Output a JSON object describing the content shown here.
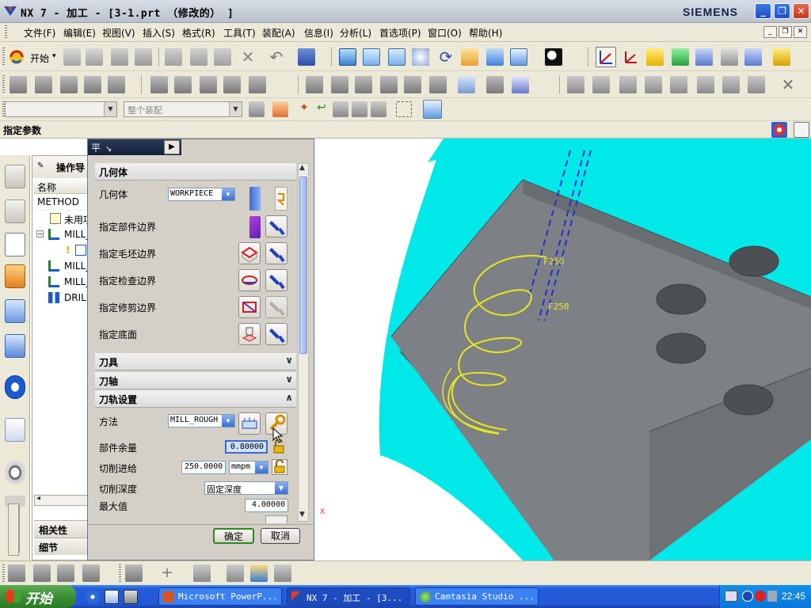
{
  "window": {
    "title": "NX 7 - 加工 - [3-1.prt （修改的） ]",
    "brand": "SIEMENS",
    "controls": [
      "_",
      "❐",
      "✕"
    ]
  },
  "menu": {
    "items": [
      "文件(F)",
      "编辑(E)",
      "视图(V)",
      "插入(S)",
      "格式(R)",
      "工具(T)",
      "装配(A)",
      "信息(I)",
      "分析(L)",
      "首选项(P)",
      "窗口(O)",
      "帮助(H)"
    ]
  },
  "toolbar": {
    "start_label": "开始",
    "start_arrow": "▾"
  },
  "selection_bar": {
    "filter_value": "",
    "scope_value": "整个装配"
  },
  "status": {
    "prompt": "指定参数"
  },
  "navigator": {
    "title": "操作导",
    "column_name": "名称",
    "rows": [
      {
        "label": "METHOD"
      },
      {
        "label": "未用项"
      },
      {
        "label": "MILL_"
      },
      {
        "label": "MILL_"
      },
      {
        "label": "MILL_"
      },
      {
        "label": "DRILL"
      }
    ],
    "bottom_tabs": [
      "相关性",
      "细节"
    ]
  },
  "dialog": {
    "title_glyph": "平",
    "geometry": {
      "header": "几何体",
      "geometry_label": "几何体",
      "geometry_value": "WORKPIECE",
      "rows": [
        "指定部件边界",
        "指定毛坯边界",
        "指定检查边界",
        "指定修剪边界",
        "指定底面"
      ]
    },
    "tool_header": "刀具",
    "axis_header": "刀轴",
    "path_settings": {
      "header": "刀轨设置",
      "method_label": "方法",
      "method_value": "MILL_ROUGH",
      "stock_label": "部件余量",
      "stock_value": "0.80000",
      "feed_label": "切削进给",
      "feed_value": "250.0000",
      "feed_unit": "mmpm",
      "depth_label": "切削深度",
      "depth_value": "固定深度",
      "max_label": "最大值",
      "max_value": "4.00000"
    },
    "ok_label": "确定",
    "cancel_label": "取消"
  },
  "viewport": {
    "feed_labels": [
      "F250",
      "F250"
    ],
    "axis_marker": "X"
  },
  "taskbar": {
    "start_label": "开始",
    "tasks": [
      {
        "label": "Microsoft PowerP..."
      },
      {
        "label": "NX 7 - 加工 - [3..."
      },
      {
        "label": "Camtasia Studio ..."
      }
    ],
    "clock": "22:45"
  },
  "colors": {
    "cyan_blank": "#00e8e8",
    "part_face": "#7d8185",
    "part_side": "#5e6266",
    "toolpath": "#e6e61e",
    "tool_axis": "#2233cc"
  }
}
